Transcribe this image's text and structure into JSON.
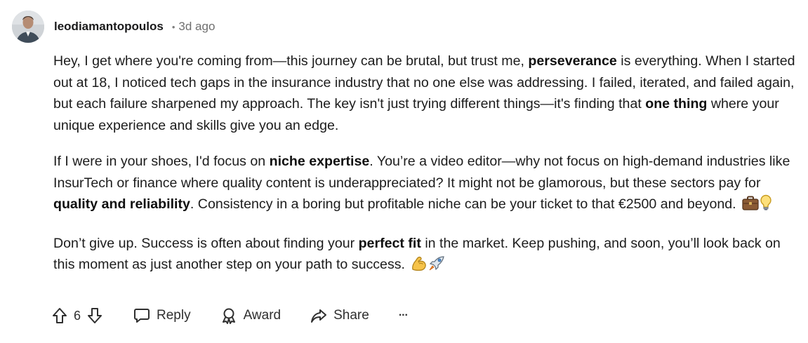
{
  "comment": {
    "author": "leodiamantopoulos",
    "separator": "•",
    "time": "3d ago",
    "paragraphs": [
      {
        "p1a": "Hey, I get where you're coming from—this journey can be brutal, but trust me, ",
        "p1b": "perseverance",
        "p1c": " is everything. When I started out at 18, I noticed tech gaps in the insurance industry that no one else was addressing. I failed, iterated, and failed again, but each failure sharpened my approach. The key isn't just trying different things—it's finding that ",
        "p1d": "one thing",
        "p1e": " where your unique experience and skills give you an edge."
      },
      {
        "p2a": "If I were in your shoes, I'd focus on ",
        "p2b": "niche expertise",
        "p2c": ". You’re a video editor—why not focus on high-demand industries like InsurTech or finance where quality content is underappreciated? It might not be glamorous, but these sectors pay for ",
        "p2d": "quality and reliability",
        "p2e": ". Consistency in a boring but profitable niche can be your ticket to that €2500 and beyond."
      },
      {
        "p3a": "Don’t give up. Success is often about finding your ",
        "p3b": "perfect fit",
        "p3c": " in the market. Keep pushing, and soon, you’ll look back on this moment as just another step on your path to success."
      }
    ]
  },
  "actions": {
    "vote_count": "6",
    "reply_label": "Reply",
    "award_label": "Award",
    "share_label": "Share",
    "more_label": "···"
  },
  "icons": {
    "upvote": "upvote-arrow-icon",
    "downvote": "downvote-arrow-icon",
    "reply": "speech-bubble-icon",
    "award": "award-ribbon-icon",
    "share": "share-arrow-icon",
    "briefcase": "briefcase-emoji",
    "lightbulb": "lightbulb-emoji",
    "flexed_biceps": "flexed-biceps-emoji",
    "rocket": "rocket-emoji"
  }
}
